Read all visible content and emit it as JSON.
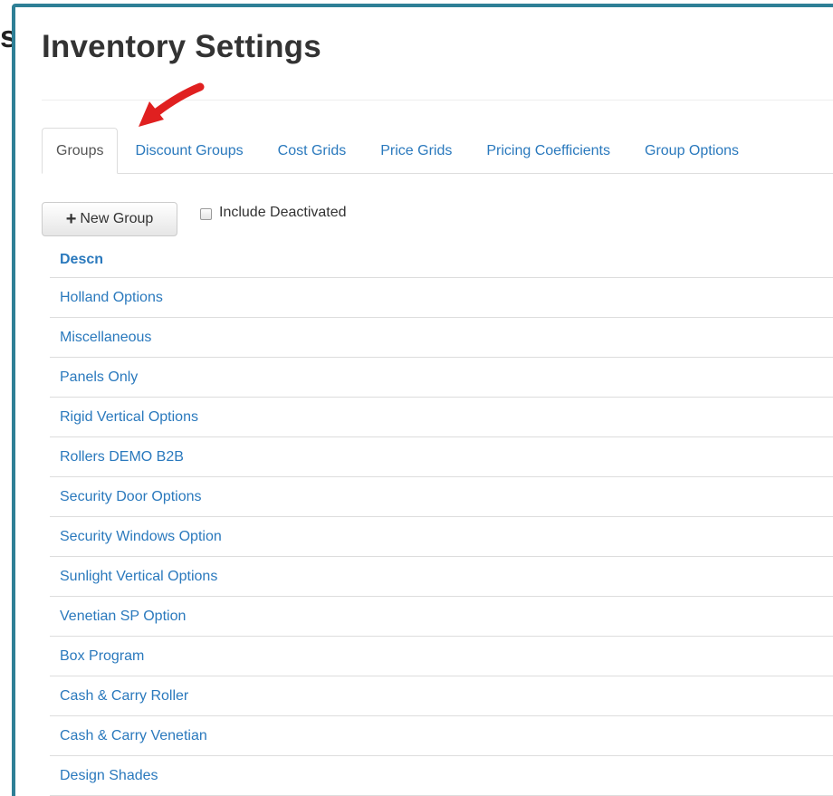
{
  "page": {
    "cut_letter": "s",
    "title": "Inventory Settings"
  },
  "colors": {
    "frame_border": "#2e7f96",
    "link": "#2a79bd",
    "annotation_arrow": "#e02020"
  },
  "tabs": [
    {
      "label": "Groups",
      "active": true
    },
    {
      "label": "Discount Groups",
      "active": false
    },
    {
      "label": "Cost Grids",
      "active": false
    },
    {
      "label": "Price Grids",
      "active": false
    },
    {
      "label": "Pricing Coefficients",
      "active": false
    },
    {
      "label": "Group Options",
      "active": false
    }
  ],
  "toolbar": {
    "new_group_label": "New Group",
    "new_group_icon": "plus-icon",
    "include_deactivated_label": "Include Deactivated",
    "include_deactivated_checked": false
  },
  "table": {
    "header": "Descn",
    "rows": [
      "Holland Options",
      "Miscellaneous",
      "Panels Only",
      "Rigid Vertical Options",
      "Rollers DEMO B2B",
      "Security Door Options",
      "Security Windows Option",
      "Sunlight Vertical Options",
      "Venetian SP Option",
      "Box Program",
      "Cash & Carry Roller",
      "Cash & Carry Venetian",
      "Design Shades"
    ]
  }
}
